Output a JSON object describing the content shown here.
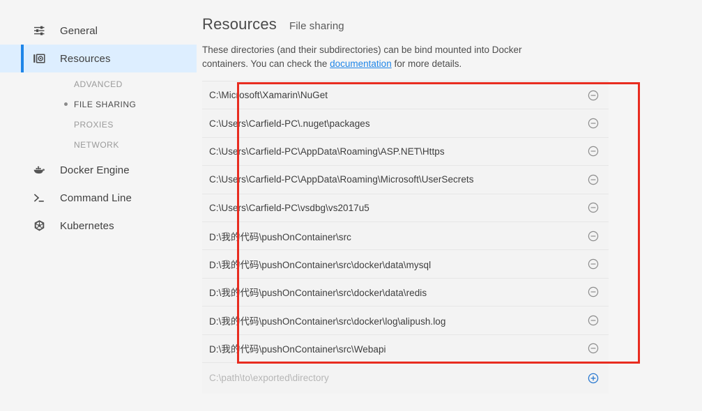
{
  "sidebar": {
    "items": [
      {
        "label": "General",
        "icon": "sliders-icon",
        "selected": false
      },
      {
        "label": "Resources",
        "icon": "resources-box-icon",
        "selected": true
      },
      {
        "label": "Docker Engine",
        "icon": "docker-whale-icon",
        "selected": false
      },
      {
        "label": "Command Line",
        "icon": "terminal-prompt-icon",
        "selected": false
      },
      {
        "label": "Kubernetes",
        "icon": "kubernetes-helm-icon",
        "selected": false
      }
    ],
    "subnav": [
      {
        "label": "ADVANCED",
        "active": false
      },
      {
        "label": "FILE SHARING",
        "active": true
      },
      {
        "label": "PROXIES",
        "active": false
      },
      {
        "label": "NETWORK",
        "active": false
      }
    ],
    "accent_color": "#1e85e8",
    "selected_background": "#ddeeff"
  },
  "header": {
    "title": "Resources",
    "subtitle": "File sharing"
  },
  "description": {
    "before_link": "These directories (and their subdirectories) can be bind mounted into Docker containers. You can check the ",
    "link_text": "documentation",
    "after_link": " for more details.",
    "link_color": "#1e85e8"
  },
  "file_sharing": {
    "remove_icon": "minus-circle-icon",
    "add_icon": "plus-circle-icon",
    "add_icon_color": "#2878d0",
    "remove_icon_color": "#8d8d8d",
    "paths": [
      "C:\\Microsoft\\Xamarin\\NuGet",
      "C:\\Users\\Carfield-PC\\.nuget\\packages",
      "C:\\Users\\Carfield-PC\\AppData\\Roaming\\ASP.NET\\Https",
      "C:\\Users\\Carfield-PC\\AppData\\Roaming\\Microsoft\\UserSecrets",
      "C:\\Users\\Carfield-PC\\vsdbg\\vs2017u5",
      "D:\\我的代码\\pushOnContainer\\src",
      "D:\\我的代码\\pushOnContainer\\src\\docker\\data\\mysql",
      "D:\\我的代码\\pushOnContainer\\src\\docker\\data\\redis",
      "D:\\我的代码\\pushOnContainer\\src\\docker\\log\\alipush.log",
      "D:\\我的代码\\pushOnContainer\\src\\Webapi"
    ],
    "new_path_placeholder": "C:\\path\\to\\exported\\directory"
  },
  "annotation": {
    "color": "#e82c20"
  }
}
